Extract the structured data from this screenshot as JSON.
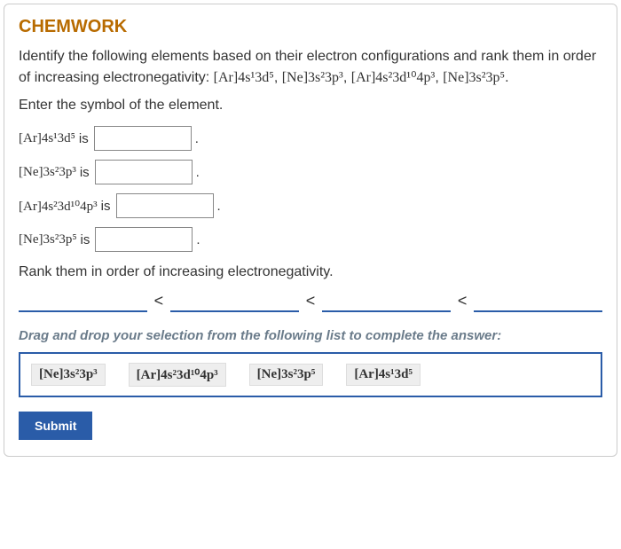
{
  "title": "CHEMWORK",
  "instr_pre": "Identify the following elements based on their electron configurations and rank them in order of increasing electronegativity: ",
  "instr_list": [
    "[Ar]4s¹3d⁵",
    "[Ne]3s²3p³",
    "[Ar]4s²3d¹⁰4p³",
    "[Ne]3s²3p⁵"
  ],
  "comma": ", ",
  "period": ".",
  "enter_prompt": "Enter the symbol of the element.",
  "is_word": "is",
  "rows": [
    {
      "ec": "[Ar]4s¹3d⁵"
    },
    {
      "ec": "[Ne]3s²3p³"
    },
    {
      "ec": "[Ar]4s²3d¹⁰4p³"
    },
    {
      "ec": "[Ne]3s²3p⁵"
    }
  ],
  "rank_prompt": "Rank them in order of increasing electronegativity.",
  "lt": "<",
  "drag_prompt": "Drag and drop your selection from the following list to complete the answer:",
  "chips": [
    "[Ne]3s²3p³",
    "[Ar]4s²3d¹⁰4p³",
    "[Ne]3s²3p⁵",
    "[Ar]4s¹3d⁵"
  ],
  "submit_label": "Submit"
}
